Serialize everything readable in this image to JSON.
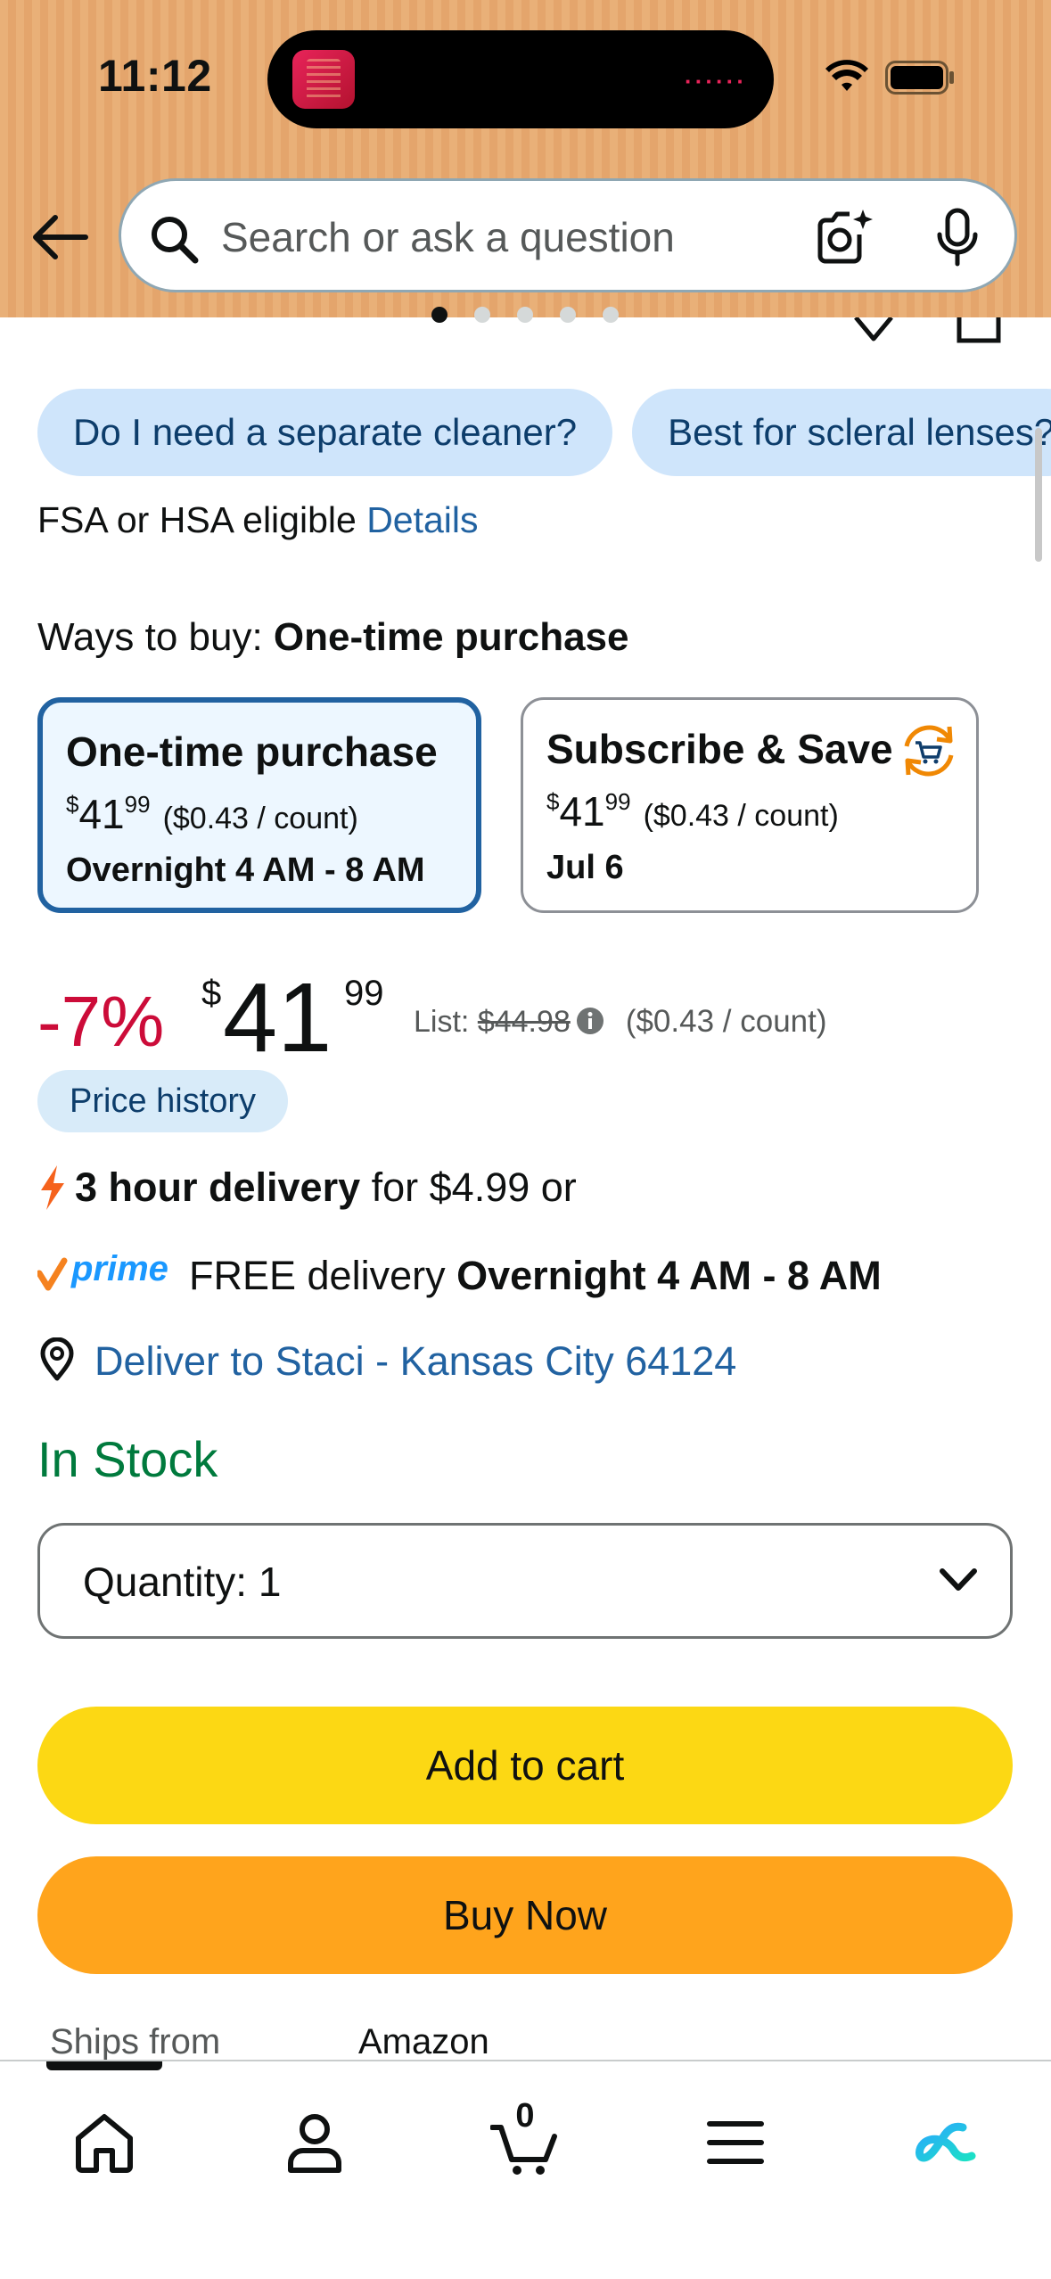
{
  "status_bar": {
    "time": "11:12"
  },
  "search": {
    "placeholder": "Search or ask a question"
  },
  "question_chips": [
    "Do I need a separate cleaner?",
    "Best for scleral lenses?"
  ],
  "fsa": {
    "text": "FSA or HSA eligible",
    "link": "Details"
  },
  "ways_to_buy": {
    "label": "Ways to buy:",
    "value": "One-time purchase"
  },
  "options": {
    "one_time": {
      "title": "One-time purchase",
      "currency": "$",
      "whole": "41",
      "fraction": "99",
      "per_count": "($0.43 / count)",
      "delivery": "Overnight 4 AM - 8 AM"
    },
    "subscribe": {
      "title": "Subscribe & Save",
      "currency": "$",
      "whole": "41",
      "fraction": "99",
      "per_count": "($0.43 / count)",
      "delivery": "Jul 6"
    }
  },
  "price": {
    "discount": "-7%",
    "currency": "$",
    "whole": "41",
    "fraction": "99",
    "list_label": "List:",
    "list_price": "$44.98",
    "per_count": "($0.43 / count)"
  },
  "price_history": "Price history",
  "delivery": {
    "fast_bold": "3 hour delivery",
    "fast_rest": "for $4.99 or",
    "prime_text": "FREE delivery",
    "prime_bold": "Overnight 4 AM - 8 AM",
    "deliver_to": "Deliver to Staci - Kansas City 64124"
  },
  "stock": "In Stock",
  "quantity": {
    "label": "Quantity:",
    "value": "1"
  },
  "buttons": {
    "add_to_cart": "Add to cart",
    "buy_now": "Buy Now"
  },
  "ships_from": {
    "label": "Ships from",
    "value": "Amazon"
  },
  "bottom_nav": {
    "cart_count": "0"
  },
  "colors": {
    "header": "#e9b078",
    "link": "#2162a1",
    "discount": "#cc0c39",
    "in_stock": "#007a3d",
    "add_to_cart": "#fcd814",
    "buy_now": "#ffa41c",
    "chip": "#cfe5fb"
  },
  "icons": [
    "back-arrow-icon",
    "search-icon",
    "camera-lens-icon",
    "microphone-icon",
    "info-icon",
    "lightning-bolt-icon",
    "prime-logo",
    "location-pin-icon",
    "chevron-down-icon",
    "subscribe-cart-icon",
    "home-icon",
    "account-icon",
    "cart-icon",
    "menu-icon",
    "rufus-icon"
  ]
}
